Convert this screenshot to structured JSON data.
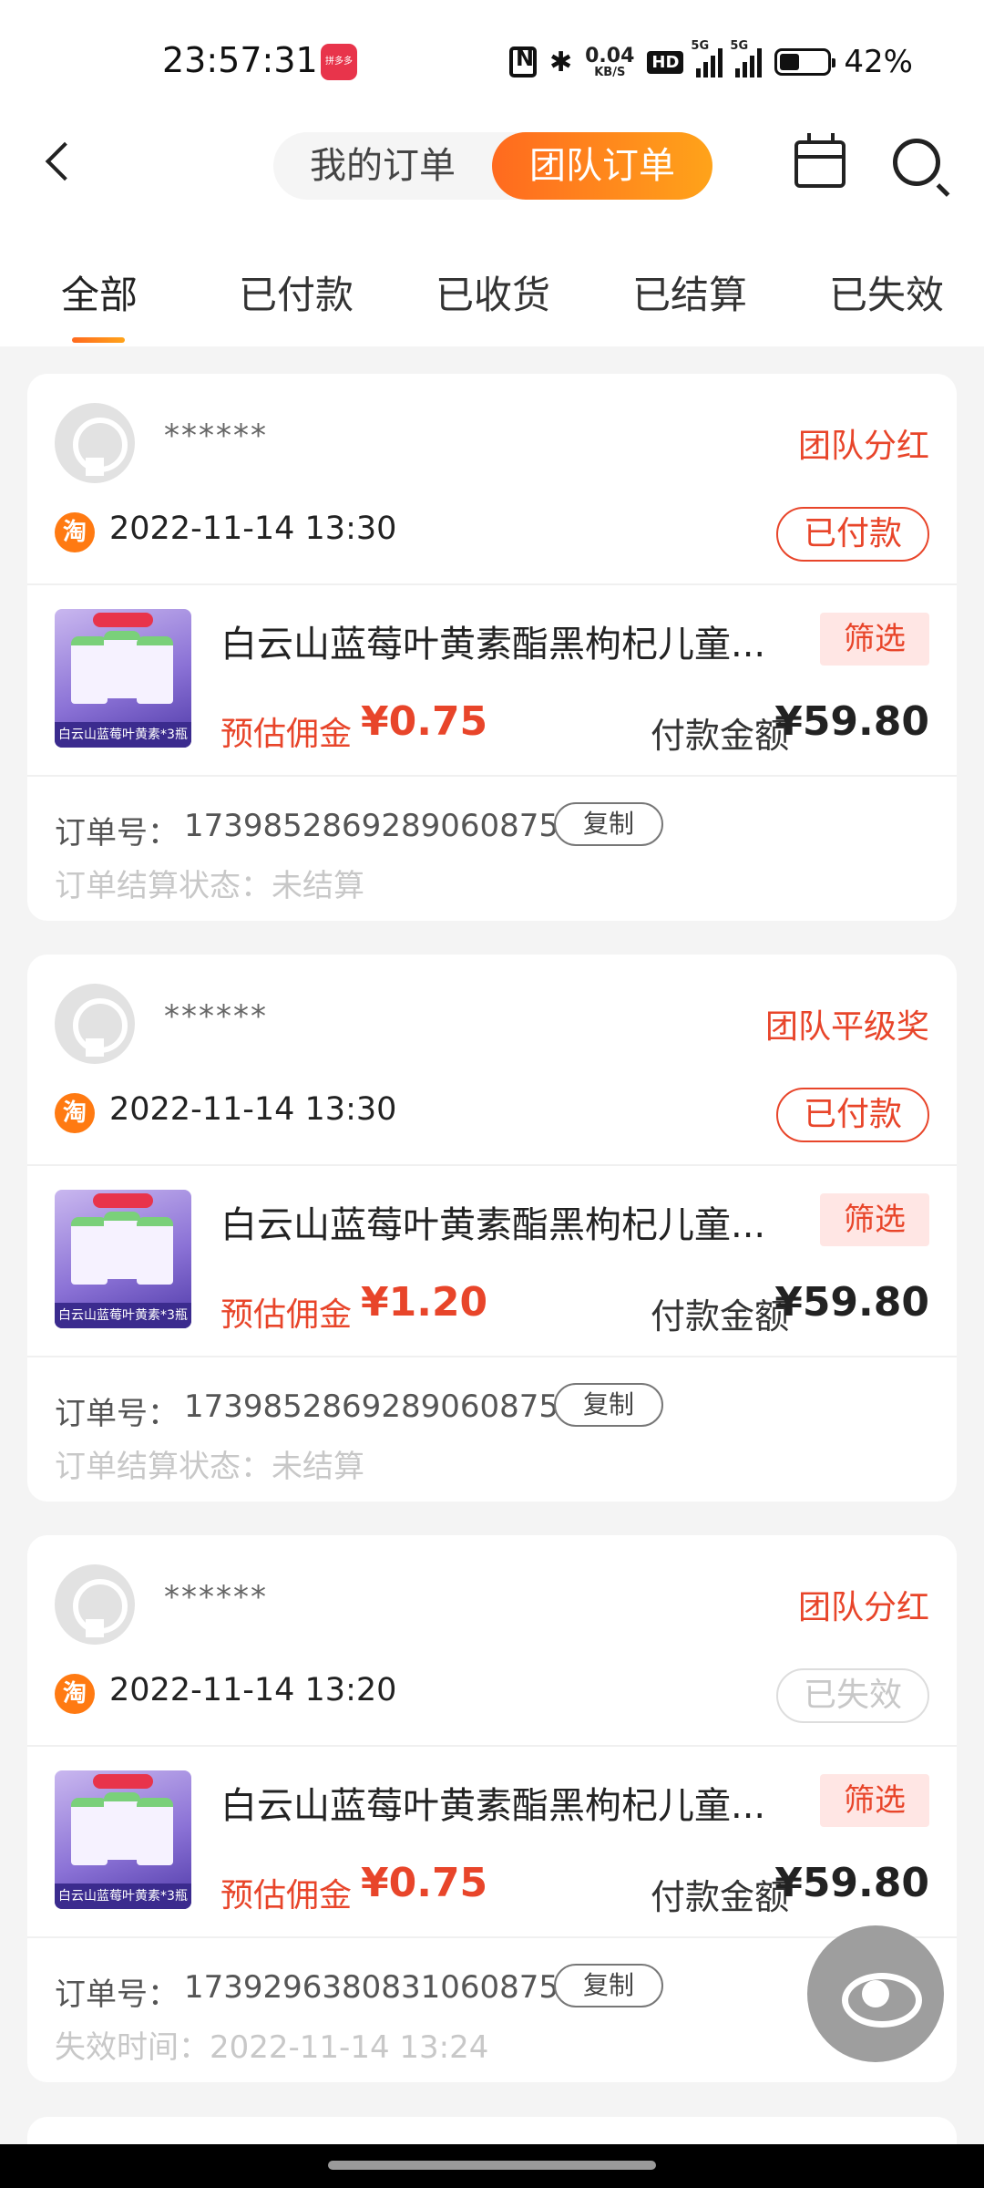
{
  "status_bar": {
    "time": "23:57:31",
    "app_icon_label": "拼多多",
    "net_speed_value": "0.04",
    "net_speed_unit": "KB/S",
    "hd_label": "HD",
    "sim1_tag": "5G",
    "sim2_tag": "5G",
    "battery_level": 0.42,
    "battery_percent": "42%"
  },
  "header": {
    "segment_left": "我的订单",
    "segment_right": "团队订单",
    "active_segment": "团队订单"
  },
  "tabs": [
    {
      "label": "全部",
      "active": true
    },
    {
      "label": "已付款",
      "active": false
    },
    {
      "label": "已收货",
      "active": false
    },
    {
      "label": "已结算",
      "active": false
    },
    {
      "label": "已失效",
      "active": false
    }
  ],
  "orders": [
    {
      "user": "******",
      "reward_type": "团队分红",
      "platform_icon": "淘",
      "time": "2022-11-14 13:30",
      "status": "已付款",
      "product_title": "白云山蓝莓叶黄素酯黑枸杞儿童...",
      "thumb_caption": "白云山蓝莓叶黄素*3瓶",
      "filter_label": "筛选",
      "commission_label": "预估佣金",
      "commission": "¥0.75",
      "pay_label": "付款金额",
      "pay_amount": "¥59.80",
      "order_no_label": "订单号：",
      "order_no": "1739852869289060875",
      "copy_label": "复制",
      "extra_label": "订单结算状态：",
      "extra_value": "未结算"
    },
    {
      "user": "******",
      "reward_type": "团队平级奖",
      "platform_icon": "淘",
      "time": "2022-11-14 13:30",
      "status": "已付款",
      "product_title": "白云山蓝莓叶黄素酯黑枸杞儿童...",
      "thumb_caption": "白云山蓝莓叶黄素*3瓶",
      "filter_label": "筛选",
      "commission_label": "预估佣金",
      "commission": "¥1.20",
      "pay_label": "付款金额",
      "pay_amount": "¥59.80",
      "order_no_label": "订单号：",
      "order_no": "1739852869289060875",
      "copy_label": "复制",
      "extra_label": "订单结算状态：",
      "extra_value": "未结算"
    },
    {
      "user": "******",
      "reward_type": "团队分红",
      "platform_icon": "淘",
      "time": "2022-11-14 13:20",
      "status": "已失效",
      "product_title": "白云山蓝莓叶黄素酯黑枸杞儿童...",
      "thumb_caption": "白云山蓝莓叶黄素*3瓶",
      "filter_label": "筛选",
      "commission_label": "预估佣金",
      "commission": "¥0.75",
      "pay_label": "付款金额",
      "pay_amount": "¥59.80",
      "order_no_label": "订单号：",
      "order_no": "1739296380831060875",
      "copy_label": "复制",
      "extra_label": "失效时间：",
      "extra_value": "2022-11-14 13:24"
    }
  ],
  "colors": {
    "accent": "#e8452a",
    "gradient_start": "#ff6a1f",
    "gradient_end": "#ffa31a",
    "filter_bg": "#ffe6e4",
    "page_bg": "#f4f4f4"
  },
  "icons": {
    "back": "back-arrow-icon",
    "calendar": "calendar-icon",
    "search": "search-icon",
    "float": "eye-icon"
  }
}
